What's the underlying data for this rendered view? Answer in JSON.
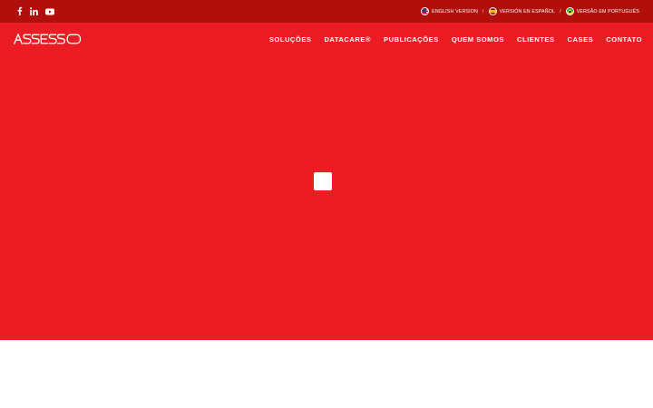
{
  "colors": {
    "topbar_bg": "#b10f0b",
    "hero_bg": "#ec1c24",
    "text": "#ffffff"
  },
  "social": [
    {
      "icon": "facebook-icon",
      "name": "Facebook"
    },
    {
      "icon": "linkedin-icon",
      "name": "LinkedIn"
    },
    {
      "icon": "youtube-icon",
      "name": "YouTube"
    }
  ],
  "languages": [
    {
      "label": "English version",
      "flag": "us-flag-icon"
    },
    {
      "label": "Versión en español",
      "flag": "spain-flag-icon"
    },
    {
      "label": "Versão em português",
      "flag": "brazil-flag-icon"
    }
  ],
  "language_separator": "/",
  "logo": {
    "text": "ASSESSO"
  },
  "nav": [
    {
      "label": "Soluções"
    },
    {
      "label": "Datacare®"
    },
    {
      "label": "Publicações"
    },
    {
      "label": "Quem Somos"
    },
    {
      "label": "Clientes"
    },
    {
      "label": "Cases"
    },
    {
      "label": "Contato"
    }
  ]
}
